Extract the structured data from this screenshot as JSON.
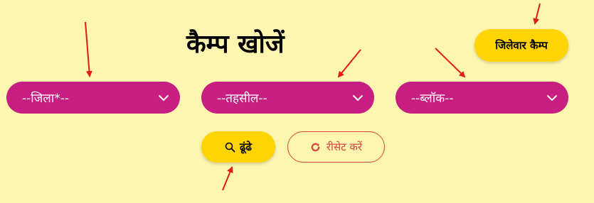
{
  "heading": "कैम्प खोजें",
  "district_wise_button": "जिलेवार कैम्प",
  "dropdowns": {
    "district": "--जिला*--",
    "tehsil": "--तहसील--",
    "block": "--ब्लॉक--"
  },
  "search_button": "ढूंढे",
  "reset_button": "रीसेट करें",
  "colors": {
    "background": "#fef5b0",
    "dropdown": "#c71e82",
    "primary_button": "#ffd400",
    "reset": "#d6453f",
    "annotation_arrow": "#e31b1b"
  },
  "icons": {
    "dropdown": "chevron-down-icon",
    "search": "search-icon",
    "reset": "refresh-icon"
  }
}
